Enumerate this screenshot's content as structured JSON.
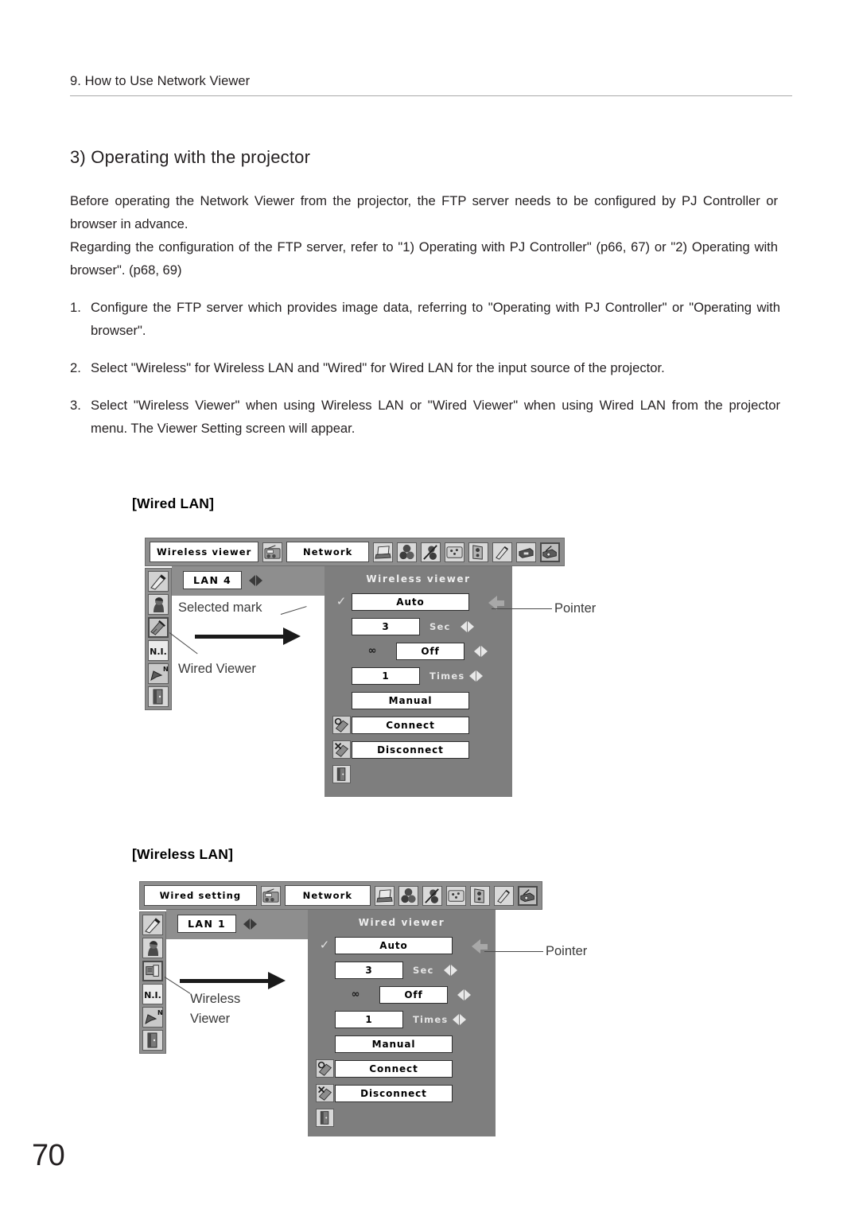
{
  "header": {
    "chapter": "9. How to Use Network Viewer"
  },
  "section": {
    "title": "3) Operating with the projector"
  },
  "intro": {
    "para1_line1": "Before operating the Network Viewer from the projector, the FTP server needs to be configured by PJ Controller or browser in advance.",
    "para1_line2": "Regarding the configuration of the FTP server, refer to \"1) Operating with PJ Controller\" (p66, 67) or \"2) Operating with browser\".  (p68, 69)"
  },
  "steps": [
    {
      "num": "1.",
      "text": "Configure the FTP server which provides image data, referring to \"Operating with PJ Controller\" or \"Operating with browser\"."
    },
    {
      "num": "2.",
      "text": "Select \"Wireless\" for Wireless LAN and \"Wired\" for Wired LAN for the input source of the projector."
    },
    {
      "num": "3.",
      "text": "Select \"Wireless Viewer\" when using Wireless LAN or \"Wired Viewer\" when using Wired LAN from the projector menu.  The Viewer Setting screen will appear."
    }
  ],
  "figures": [
    {
      "caption": "[Wired LAN]",
      "osd": {
        "menu_title": "Wireless viewer",
        "category": "Network",
        "lan_value": "LAN 4",
        "panel_title": "Wireless viewer",
        "rows": [
          {
            "lead": "check",
            "value": "Auto",
            "unit": "",
            "arrows": false,
            "wide": true
          },
          {
            "lead": "",
            "value": "3",
            "unit": "Sec",
            "arrows": true,
            "wide": false
          },
          {
            "lead": "inf",
            "value": "Off",
            "unit": "",
            "arrows": true,
            "wide": false
          },
          {
            "lead": "",
            "value": "1",
            "unit": "Times",
            "arrows": true,
            "wide": false
          },
          {
            "lead": "",
            "value": "Manual",
            "unit": "",
            "arrows": false,
            "wide": true
          },
          {
            "lead": "connect-icon",
            "value": "Connect",
            "unit": "",
            "arrows": false,
            "wide": true
          },
          {
            "lead": "disconnect-icon",
            "value": "Disconnect",
            "unit": "",
            "arrows": false,
            "wide": true
          },
          {
            "lead": "exit-icon",
            "value": "",
            "unit": "",
            "arrows": false,
            "wide": false
          }
        ],
        "topbar_icons": [
          "radio-icon",
          "laptop-icon",
          "spheres-icon",
          "spheres-slash-icon",
          "image-icon",
          "speaker-icon",
          "tools-icon",
          "projector-icon",
          "network-projector-icon"
        ],
        "sidebar_icons": [
          "pen-icon",
          "person-icon",
          "wired-viewer-icon",
          "n-i-icon",
          "arrow-mouse-icon",
          "exit-door-icon"
        ],
        "selected_topbar_index": 8,
        "selected_sidebar_index": 2,
        "infinity_symbol": "∞"
      },
      "annotations": {
        "selected_mark": "Selected mark",
        "sidebar_callout": "Wired Viewer",
        "pointer": "Pointer"
      }
    },
    {
      "caption": "[Wireless LAN]",
      "osd": {
        "menu_title": "Wired setting",
        "category": "Network",
        "lan_value": "LAN 1",
        "panel_title": "Wired viewer",
        "rows": [
          {
            "lead": "check",
            "value": "Auto",
            "unit": "",
            "arrows": false,
            "wide": true
          },
          {
            "lead": "",
            "value": "3",
            "unit": "Sec",
            "arrows": true,
            "wide": false
          },
          {
            "lead": "inf",
            "value": "Off",
            "unit": "",
            "arrows": true,
            "wide": false
          },
          {
            "lead": "",
            "value": "1",
            "unit": "Times",
            "arrows": true,
            "wide": false
          },
          {
            "lead": "",
            "value": "Manual",
            "unit": "",
            "arrows": false,
            "wide": true
          },
          {
            "lead": "connect-icon",
            "value": "Connect",
            "unit": "",
            "arrows": false,
            "wide": true
          },
          {
            "lead": "disconnect-icon",
            "value": "Disconnect",
            "unit": "",
            "arrows": false,
            "wide": true
          },
          {
            "lead": "exit-icon",
            "value": "",
            "unit": "",
            "arrows": false,
            "wide": false
          }
        ],
        "topbar_icons": [
          "radio-icon",
          "laptop-icon",
          "spheres-icon",
          "spheres-slash-icon",
          "image-icon",
          "speaker-icon",
          "tools-icon",
          "network-projector-icon"
        ],
        "sidebar_icons": [
          "pen-icon",
          "person-icon",
          "wireless-viewer-icon",
          "n-i-icon",
          "arrow-mouse-icon",
          "exit-door-icon"
        ],
        "selected_topbar_index": 7,
        "selected_sidebar_index": 2,
        "infinity_symbol": "∞"
      },
      "annotations": {
        "selected_mark": "",
        "sidebar_callout": "Wireless\nViewer",
        "pointer": "Pointer"
      }
    }
  ],
  "page_number": "70"
}
